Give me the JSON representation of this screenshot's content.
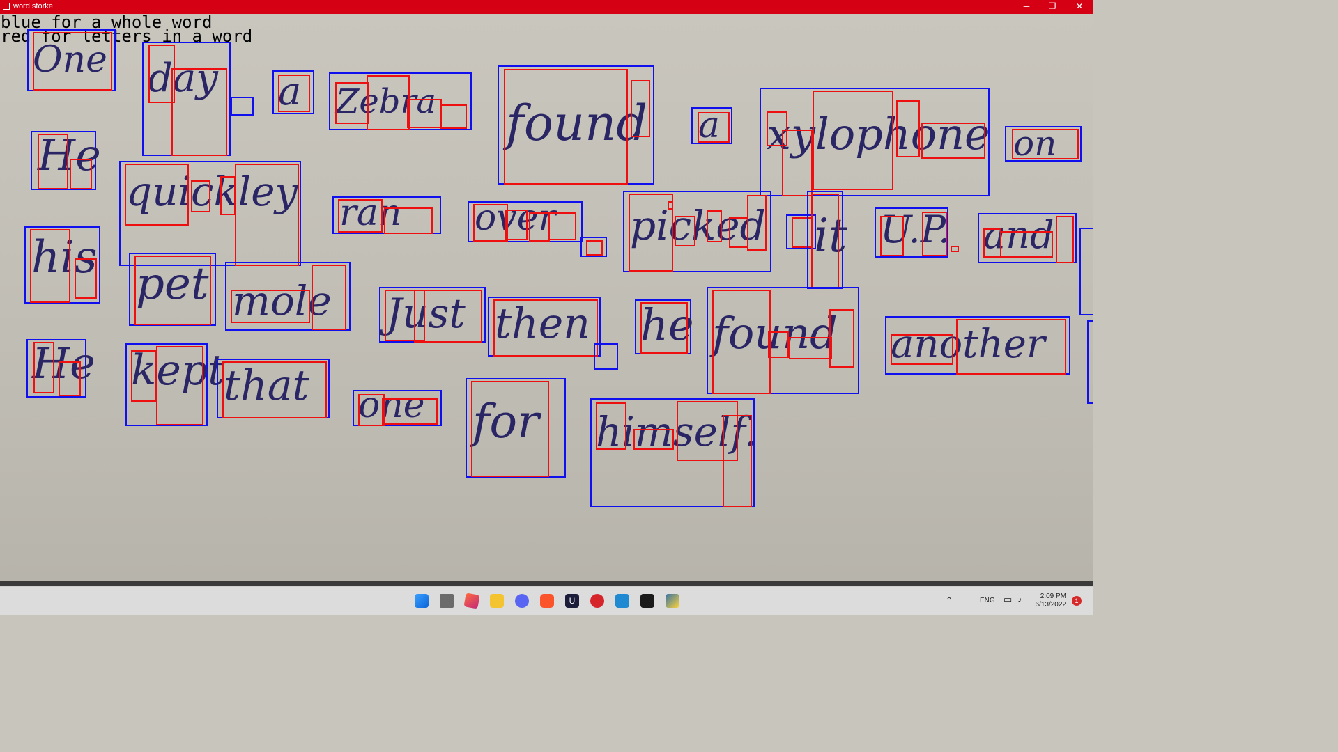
{
  "window": {
    "title": "word storke",
    "minimize": "─",
    "restore": "❐",
    "close": "✕"
  },
  "legend": {
    "line1": "blue for a whole word",
    "line2": "red for letters in a word"
  },
  "colors": {
    "word_box": "#1010ee",
    "letter_box": "#ee1010",
    "titlebar": "#d60014"
  },
  "words": [
    "One",
    "day",
    "a",
    "Zebra",
    "found",
    "a",
    "xylophone",
    "on",
    "He",
    "quickley",
    "ran",
    "over",
    "picked",
    "it",
    "U.P.",
    "and",
    "his",
    "pet",
    "mole",
    "Just",
    "then",
    "he",
    "found",
    "another",
    "He",
    "kept",
    "that",
    "one",
    "for",
    "himself."
  ],
  "taskbar": {
    "apps": [
      "start-icon",
      "task-view-icon",
      "3d-box-icon",
      "file-explorer-icon",
      "discord-icon",
      "brave-icon",
      "ultimate-icon",
      "hotspot-icon",
      "vscode-icon",
      "terminal-icon",
      "python-icon"
    ],
    "language": "ENG",
    "time": "2:09 PM",
    "date": "6/13/2022",
    "notification_count": "1"
  }
}
